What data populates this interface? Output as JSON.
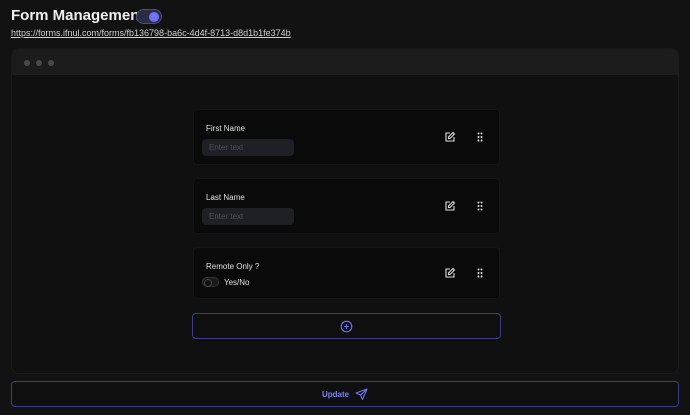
{
  "header": {
    "title": "Form Management",
    "toggle_on": true,
    "url": "https://forms.ifnul.com/forms/fb136798-ba6c-4d4f-8713-d8d1b1fe374b"
  },
  "fields": [
    {
      "label": "First Name",
      "placeholder": "Enter text"
    },
    {
      "label": "Last Name",
      "placeholder": "Enter text"
    },
    {
      "label": "Remote Only ?",
      "switch_label": "Yes/No"
    }
  ],
  "icons": {
    "edit": "edit-icon",
    "drag": "drag-handle-icon",
    "add": "plus-circle-icon",
    "send": "send-icon"
  },
  "update_label": "Update",
  "colors": {
    "accent": "#6d72f6",
    "bg": "#121212"
  }
}
